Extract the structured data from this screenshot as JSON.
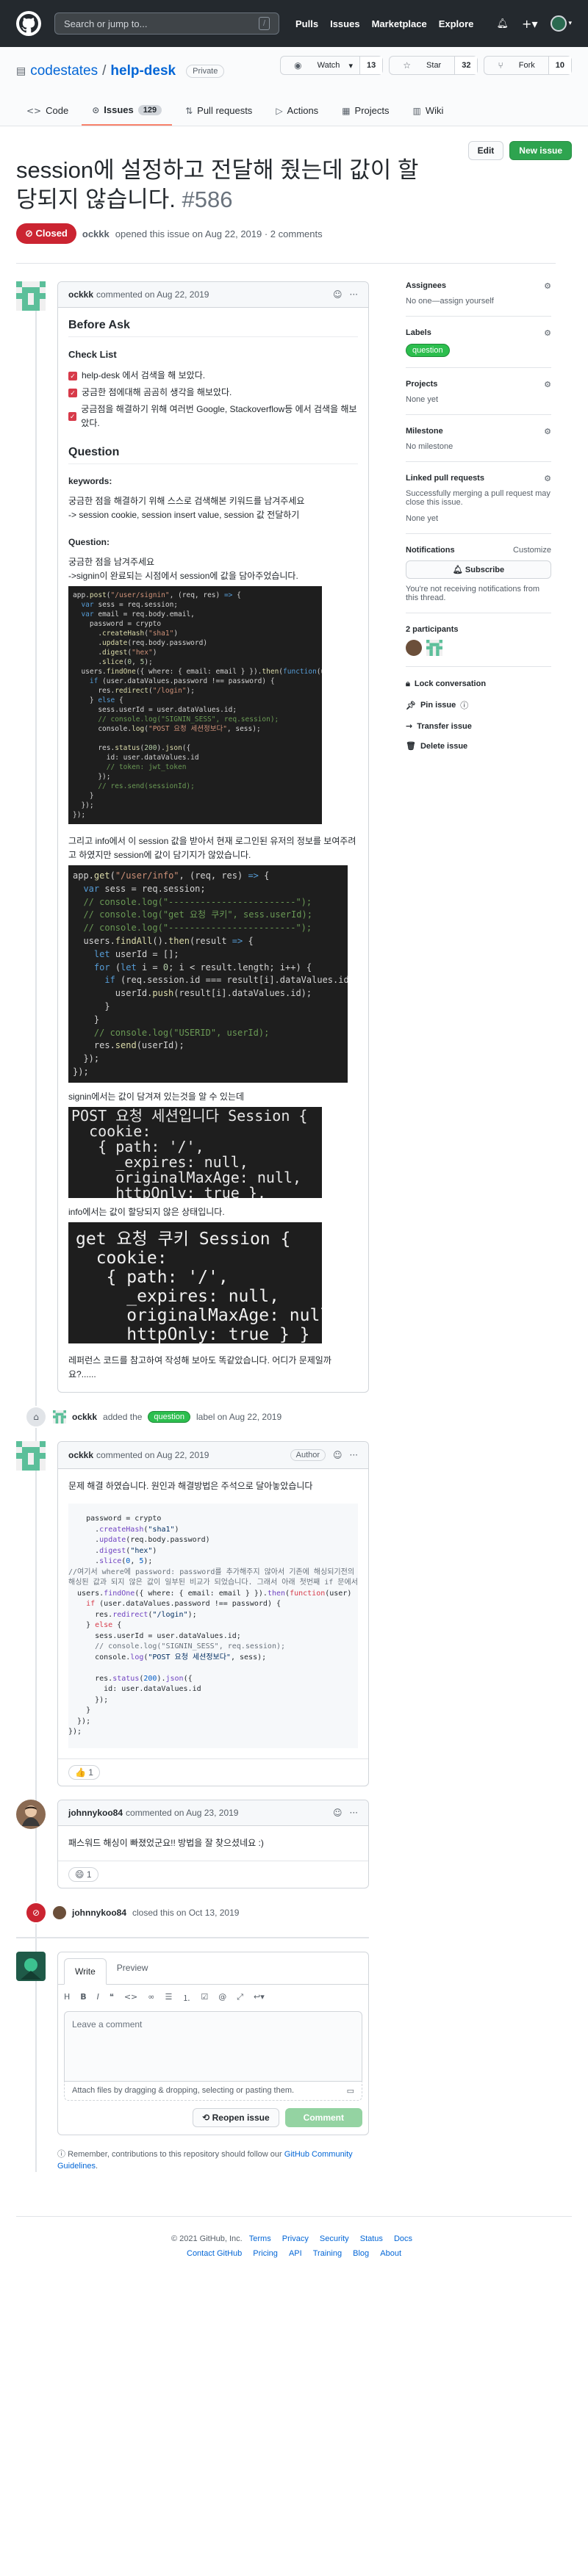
{
  "header": {
    "search_placeholder": "Search or jump to...",
    "search_key": "/",
    "nav": [
      "Pulls",
      "Issues",
      "Marketplace",
      "Explore"
    ]
  },
  "repo": {
    "owner": "codestates",
    "name": "help-desk",
    "visibility": "Private",
    "watch_label": "Watch",
    "watch_count": "13",
    "star_label": "Star",
    "star_count": "32",
    "fork_label": "Fork",
    "fork_count": "10"
  },
  "tabs": [
    {
      "label": "Code"
    },
    {
      "label": "Issues",
      "count": "129"
    },
    {
      "label": "Pull requests"
    },
    {
      "label": "Actions"
    },
    {
      "label": "Projects"
    },
    {
      "label": "Wiki"
    }
  ],
  "issue": {
    "title": "session에 설정하고 전달해 줬는데 값이 할당되지 않습니다.",
    "number": "#586",
    "edit_label": "Edit",
    "new_label": "New issue",
    "state": "Closed",
    "author": "ockkk",
    "meta_text": "opened this issue on Aug 22, 2019 · 2 comments"
  },
  "comment1": {
    "author": "ockkk",
    "date": "commented on Aug 22, 2019",
    "h_before": "Before Ask",
    "h_checklist": "Check List",
    "checks": [
      "help-desk 에서 검색을 해 보았다.",
      "궁금한 점에대해 곰곰히 생각을 해보았다.",
      "궁금점을 해결하기 위해 여러번 Google, Stackoverflow등 에서 검색을 해보았다."
    ],
    "h_question": "Question",
    "keywords_label": "keywords:",
    "keywords_text1": "궁금한 점을 해결하기 위해 스스로 검색해본 키워드를 남겨주세요",
    "keywords_text2": "-> session cookie, session insert value, session 값 전달하기",
    "question_label": "Question:",
    "q_text1": "궁금한 점을 남겨주세요",
    "q_text2": "->signin이 완료되는 시점에서 session에 값을 담아주었습니다.",
    "q_text3": "그리고 info에서 이 session 값을 받아서 현재 로그인된 유저의 정보를 보여주려고 하였지만 session에 값이 담기지가 않았습니다.",
    "q_text4": "signin에서는 값이 담겨져 있는것을 알 수 있는데",
    "q_text5": "info에서는 값이 할당되지 않은 상태입니다.",
    "q_text6": "레퍼런스 코드를 참고하여 작성해 보아도 똑같았습니다. 어디가 문제일까요?......"
  },
  "event_label": {
    "actor": "ockkk",
    "text1": "added the",
    "label": "question",
    "text2": "label on Aug 22, 2019"
  },
  "comment2": {
    "author": "ockkk",
    "date": "commented on Aug 22, 2019",
    "badge": "Author",
    "text": "문제 해결 하였습니다. 원인과 해결방법은 주석으로 달아놓았습니다",
    "reaction_emoji": "👍",
    "reaction_count": "1"
  },
  "comment3": {
    "author": "johnnykoo84",
    "date": "commented on Aug 23, 2019",
    "text": "패스워드 해싱이 빠졌었군요!! 방법을 잘 찾으셨네요 :)",
    "reaction_emoji": "😄",
    "reaction_count": "1"
  },
  "event_closed": {
    "actor": "johnnykoo84",
    "text": "closed this on Oct 13, 2019"
  },
  "new_comment": {
    "tab_write": "Write",
    "tab_preview": "Preview",
    "placeholder": "Leave a comment",
    "attach_text": "Attach files by dragging & dropping, selecting or pasting them.",
    "reopen_label": "Reopen issue",
    "comment_label": "Comment"
  },
  "remember": {
    "text": "Remember, contributions to this repository should follow our",
    "link": "GitHub Community Guidelines",
    "end": "."
  },
  "sidebar": {
    "assignees_title": "Assignees",
    "assignees_value": "No one—assign yourself",
    "labels_title": "Labels",
    "label_value": "question",
    "projects_title": "Projects",
    "projects_value": "None yet",
    "milestone_title": "Milestone",
    "milestone_value": "No milestone",
    "linked_title": "Linked pull requests",
    "linked_text": "Successfully merging a pull request may close this issue.",
    "linked_value": "None yet",
    "notif_title": "Notifications",
    "notif_customize": "Customize",
    "subscribe_label": "Subscribe",
    "notif_text": "You're not receiving notifications from this thread.",
    "participants_title": "2 participants",
    "lock_label": "Lock conversation",
    "pin_label": "Pin issue",
    "transfer_label": "Transfer issue",
    "delete_label": "Delete issue"
  },
  "footer": {
    "copyright": "© 2021 GitHub, Inc.",
    "links1": [
      "Terms",
      "Privacy",
      "Security",
      "Status",
      "Docs"
    ],
    "links2": [
      "Contact GitHub",
      "Pricing",
      "API",
      "Training",
      "Blog",
      "About"
    ]
  },
  "colors": {
    "header_bg": "#24292e",
    "closed": "#cb2431",
    "accent_green": "#2ea44f",
    "link": "#0366d6"
  }
}
